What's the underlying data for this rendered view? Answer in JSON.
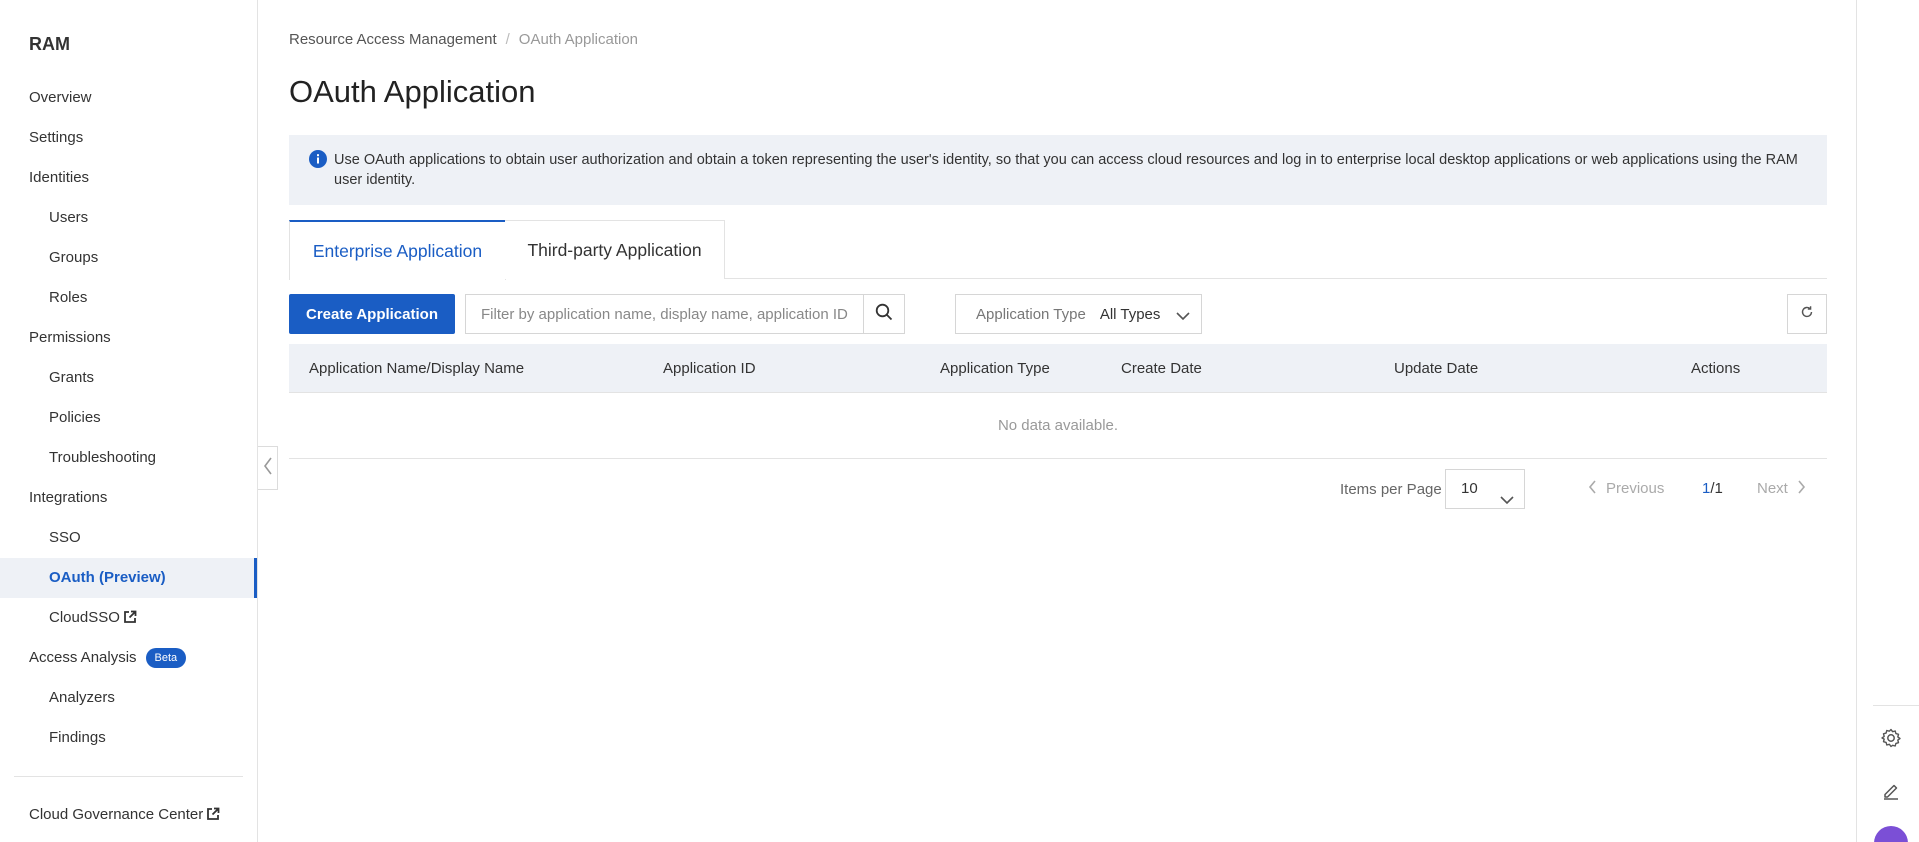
{
  "sidebar": {
    "brand": "RAM",
    "items": [
      {
        "label": "Overview"
      },
      {
        "label": "Settings"
      },
      {
        "label": "Identities"
      },
      {
        "label": "Users"
      },
      {
        "label": "Groups"
      },
      {
        "label": "Roles"
      },
      {
        "label": "Permissions"
      },
      {
        "label": "Grants"
      },
      {
        "label": "Policies"
      },
      {
        "label": "Troubleshooting"
      },
      {
        "label": "Integrations"
      },
      {
        "label": "SSO"
      },
      {
        "label": "OAuth (Preview)"
      },
      {
        "label": "CloudSSO"
      },
      {
        "label": "Access Analysis",
        "badge": "Beta"
      },
      {
        "label": "Analyzers"
      },
      {
        "label": "Findings"
      }
    ],
    "footer_link": "Cloud Governance Center"
  },
  "breadcrumb": {
    "root": "Resource Access Management",
    "separator": "/",
    "current": "OAuth Application"
  },
  "page": {
    "title": "OAuth Application",
    "notice": "Use OAuth applications to obtain user authorization and obtain a token representing the user's identity, so that you can access cloud resources and log in to enterprise local desktop applications or web applications using the RAM user identity."
  },
  "tabs": [
    {
      "label": "Enterprise Application",
      "active": true
    },
    {
      "label": "Third-party Application",
      "active": false
    }
  ],
  "toolbar": {
    "create_label": "Create Application",
    "search_placeholder": "Filter by application name, display name, application ID",
    "search_value": "",
    "type_filter_label": "Application Type",
    "type_filter_value": "All Types"
  },
  "table": {
    "columns": [
      "Application Name/Display Name",
      "Application ID",
      "Application Type",
      "Create Date",
      "Update Date",
      "Actions"
    ],
    "rows": [],
    "empty_text": "No data available."
  },
  "pagination": {
    "items_per_page_label": "Items per Page",
    "items_per_page": "10",
    "prev_label": "Previous",
    "current_page": "1",
    "page_separator": "/",
    "total_pages": "1",
    "next_label": "Next"
  },
  "colors": {
    "accent": "#1a5dc4",
    "notice_bg": "#eef1f6",
    "table_header_bg": "#eef1f6"
  }
}
